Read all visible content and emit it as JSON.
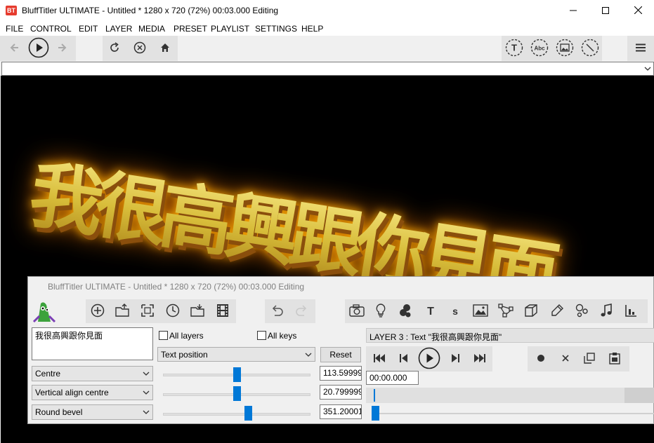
{
  "window": {
    "logo": "BT",
    "title": "BluffTitler ULTIMATE  - Untitled * 1280 x 720 (72%) 00:03.000 Editing",
    "controls": [
      "minimize-icon",
      "maximize-icon",
      "close-icon"
    ]
  },
  "menu": {
    "items": [
      "FILE",
      "CONTROL",
      "EDIT",
      "LAYER",
      "MEDIA",
      "PRESET",
      "PLAYLIST",
      "SETTINGS",
      "HELP"
    ]
  },
  "toolbar": {
    "nav_icons": [
      "back-arrow-icon",
      "play-circle-icon",
      "forward-arrow-icon"
    ],
    "action_icons": [
      "refresh-icon",
      "stop-circle-icon",
      "home-icon"
    ],
    "right_icons": [
      "text-circle-icon",
      "abc-circle-icon",
      "image-circle-icon",
      "no-circle-icon"
    ],
    "menu_icon": "hamburger-icon"
  },
  "preset_combo": {
    "value": ""
  },
  "preview": {
    "text": "我很高興跟你見面",
    "colors": {
      "glow": "#ff8c00",
      "face": "#d9c23a",
      "side": "#9a5a10"
    }
  },
  "sub_window": {
    "title": "BluffTitler ULTIMATE  - Untitled * 1280 x 720 (72%) 00:03.000 Editing",
    "text_field": "我很高興跟你見面",
    "all_layers_label": "All layers",
    "all_keys_label": "All keys",
    "property_select": "Text position",
    "reset_label": "Reset",
    "layer_info": "LAYER 3 : Text \"我很高興跟你見面\"",
    "time_value": "00:00.000",
    "dropdowns": [
      "Centre",
      "Vertical align centre",
      "Round bevel"
    ],
    "values": [
      "113.59999",
      "20.799999",
      "351.20001"
    ],
    "slider_levels": [
      0.5,
      0.5,
      0.58
    ],
    "layer_icons": [
      "add-circle-icon",
      "open-folder-icon",
      "selection-icon",
      "clock-icon",
      "import-folder-icon",
      "film-icon"
    ],
    "edit_icons": [
      "undo-icon",
      "redo-icon"
    ],
    "type_icons": [
      "camera-icon",
      "lightbulb-icon",
      "particles-icon",
      "text-t-icon",
      "text-s-icon",
      "picture-icon",
      "shape-icon",
      "cube-icon",
      "brush-icon",
      "dots-icon",
      "music-note-icon",
      "chart-icon"
    ],
    "transport_icons": [
      "skip-start-icon",
      "step-back-icon",
      "play-icon",
      "step-forward-icon",
      "skip-end-icon"
    ],
    "key_icons": [
      "record-dot-icon",
      "delete-x-icon",
      "copy-icon",
      "paste-icon"
    ],
    "accent": "#0078d7"
  }
}
